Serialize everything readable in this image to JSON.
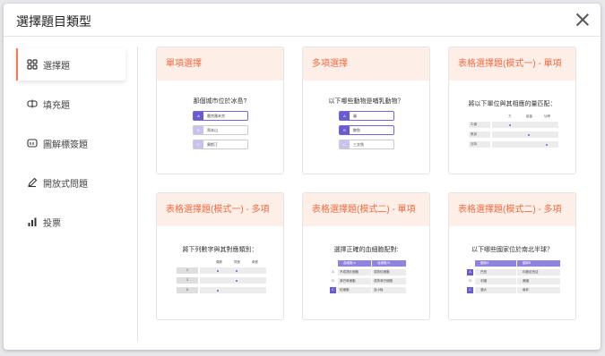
{
  "modal": {
    "title": "選擇題目類型"
  },
  "sidebar": {
    "items": [
      {
        "label": "選擇題",
        "icon": "grid-squares-icon"
      },
      {
        "label": "填充題",
        "icon": "input-box-icon"
      },
      {
        "label": "圖解標簽題",
        "icon": "image-label-icon"
      },
      {
        "label": "開放式問題",
        "icon": "pencil-icon"
      },
      {
        "label": "投票",
        "icon": "bar-chart-icon"
      }
    ]
  },
  "cards": [
    {
      "title": "單項選擇",
      "question": "那個城市位於冰島?",
      "options": [
        {
          "letter": "A",
          "text": "雷克雅未克",
          "selected": true
        },
        {
          "letter": "B",
          "text": "哥本山",
          "selected": false
        },
        {
          "letter": "C",
          "text": "奧斯汀",
          "selected": false
        }
      ]
    },
    {
      "title": "多項選擇",
      "question": "以下哪些動物是哺乳動物？",
      "options": [
        {
          "letter": "A",
          "text": "貓",
          "selected": true
        },
        {
          "letter": "B",
          "text": "鯨魚",
          "selected": true
        },
        {
          "letter": "C",
          "text": "三文魚",
          "selected": false
        }
      ]
    },
    {
      "title": "表格選擇題(模式一) - 單項",
      "question": "將以下單位與其相應的量匹配：",
      "columns": [
        "力",
        "能量",
        "功率"
      ],
      "rows": [
        {
          "label": "牛頓",
          "checked": 0
        },
        {
          "label": "焦耳",
          "checked": 1
        },
        {
          "label": "瓦特",
          "checked": 2
        }
      ]
    },
    {
      "title": "表格選擇題(模式一) - 多項",
      "question": "將下列數字與其對應類別：",
      "columns": [
        "偶數",
        "質數",
        "奇數"
      ],
      "rows": [
        {
          "label": "2",
          "checked": [
            0,
            1
          ]
        },
        {
          "label": "3",
          "checked": [
            1
          ]
        },
        {
          "label": "8",
          "checked": [
            0
          ]
        }
      ]
    },
    {
      "title": "表格選擇題(模式二) - 單項",
      "question": "選擇正確的血細胞配對:",
      "header_left": "血細胞 A",
      "header_right": "血細胞 B",
      "rows": [
        {
          "letter": "A",
          "left": "不成熟紅細胞",
          "right": "成熟紅細胞",
          "on": false
        },
        {
          "letter": "B",
          "left": "淋巴母細胞",
          "right": "成熟淋巴細胞",
          "on": false
        },
        {
          "letter": "C",
          "left": "紅細胞",
          "right": "血小板",
          "on": true
        }
      ]
    },
    {
      "title": "表格選擇題(模式二) - 多項",
      "question": "以下哪些國家位於南北半球？",
      "header_left": "國家A",
      "header_right": "國家B",
      "rows": [
        {
          "letter": "A",
          "left": "巴西",
          "right": "印度尼西亞",
          "on": true
        },
        {
          "letter": "B",
          "left": "中國",
          "right": "美國",
          "on": false
        },
        {
          "letter": "C",
          "left": "澳大",
          "right": "南非",
          "on": true
        }
      ]
    }
  ]
}
